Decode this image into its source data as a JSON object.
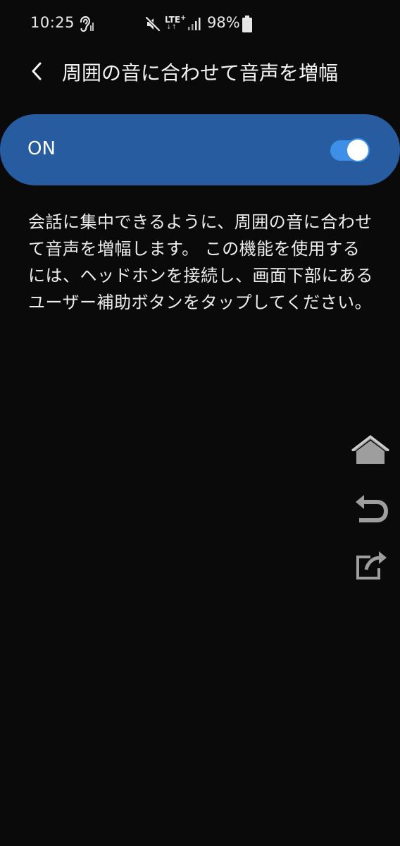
{
  "status_bar": {
    "time": "10:25",
    "network": "LTE",
    "network_plus": "+",
    "network_arrows": "↓↑",
    "battery_percent": "98%",
    "icons": [
      "hearing-icon",
      "mute-icon",
      "signal-icon",
      "battery-icon"
    ]
  },
  "header": {
    "title": "周囲の音に合わせて音声を増幅",
    "back_icon": "chevron-left-icon"
  },
  "master_switch": {
    "label": "ON",
    "state": "on",
    "accent_color": "#3d8fe8",
    "bar_color": "#275ca0"
  },
  "description": {
    "text": "会話に集中できるように、周囲の音に合わせて音声を増幅します。 この機能を使用するには、ヘッドホンを接続し、画面下部にあるユーザー補助ボタンをタップしてください。"
  },
  "side_buttons": {
    "icons": [
      "home-icon",
      "undo-icon",
      "share-icon"
    ]
  }
}
